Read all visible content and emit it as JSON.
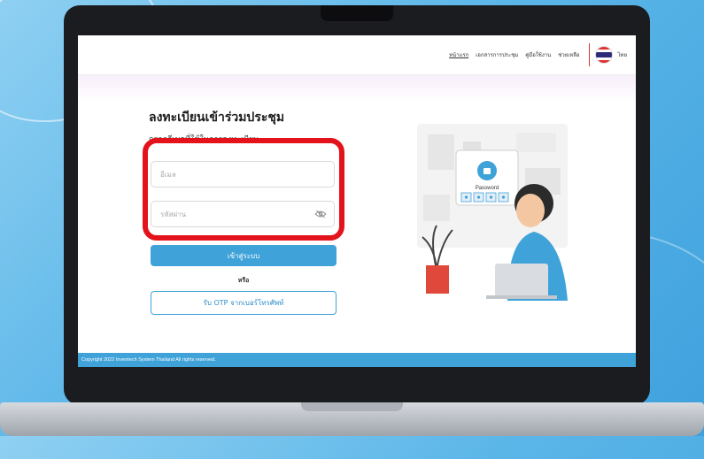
{
  "nav": {
    "items": [
      {
        "label": "หน้าแรก",
        "active": true
      },
      {
        "label": "เอกสารการประชุม",
        "active": false
      },
      {
        "label": "คู่มือใช้งาน",
        "active": false
      },
      {
        "label": "ช่วยเหลือ",
        "active": false
      }
    ],
    "language": "ไทย",
    "flag_icon": "thai-flag-icon"
  },
  "form": {
    "title": "ลงทะเบียนเข้าร่วมประชุม",
    "subtitle": "กรอกอีเมลที่ใช้ในการลงทะเบียน",
    "email_placeholder": "อีเมล",
    "email_value": "",
    "password_placeholder": "รหัสผ่าน",
    "password_value": "",
    "password_toggle_icon": "eye-off-icon",
    "login_label": "เข้าสู่ระบบ",
    "or_label": "หรือ",
    "otp_label": "รับ OTP จากเบอร์โทรศัพท์"
  },
  "illustration": {
    "password_label": "Password"
  },
  "footer": {
    "copyright": "Copyright 2022 Inventech System Thailand All rights reserved."
  },
  "colors": {
    "accent": "#3fa2d9",
    "highlight": "#e3121b",
    "background": "#5bb6e8"
  }
}
